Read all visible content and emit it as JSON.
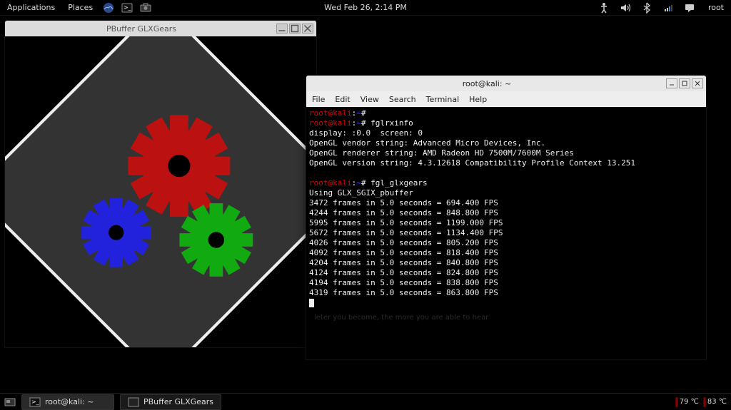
{
  "panel": {
    "applications": "Applications",
    "places": "Places",
    "datetime": "Wed Feb 26,  2:14 PM",
    "user": "root"
  },
  "glxgears_window": {
    "title": "PBuffer GLXGears"
  },
  "terminal_window": {
    "title": "root@kali: ~",
    "menus": {
      "file": "File",
      "edit": "Edit",
      "view": "View",
      "search": "Search",
      "terminal": "Terminal",
      "help": "Help"
    },
    "prompt": {
      "user": "root",
      "host": "kali",
      "path": "~",
      "sep": "@",
      "marker": "#"
    },
    "lines": {
      "cmd1": "",
      "cmd2": "fglrxinfo",
      "out_display": "display: :0.0  screen: 0",
      "out_vendor": "OpenGL vendor string: Advanced Micro Devices, Inc.",
      "out_renderer": "OpenGL renderer string: AMD Radeon HD 7500M/7600M Series",
      "out_version": "OpenGL version string: 4.3.12618 Compatibility Profile Context 13.251",
      "blank": "",
      "cmd3": "fgl_glxgears",
      "using": "Using GLX_SGIX_pbuffer",
      "fps": [
        "3472 frames in 5.0 seconds = 694.400 FPS",
        "4244 frames in 5.0 seconds = 848.800 FPS",
        "5995 frames in 5.0 seconds = 1199.000 FPS",
        "5672 frames in 5.0 seconds = 1134.400 FPS",
        "4026 frames in 5.0 seconds = 805.200 FPS",
        "4092 frames in 5.0 seconds = 818.400 FPS",
        "4204 frames in 5.0 seconds = 840.800 FPS",
        "4124 frames in 5.0 seconds = 824.800 FPS",
        "4194 frames in 5.0 seconds = 838.800 FPS",
        "4319 frames in 5.0 seconds = 863.800 FPS"
      ]
    }
  },
  "taskbar": {
    "task1": "root@kali: ~",
    "task2": "PBuffer GLXGears"
  },
  "temps": {
    "t1": "79 ℃",
    "t2": "83 ℃"
  },
  "watermark": "ieter you become, the more you are able to hear",
  "chart_data": {
    "type": "table",
    "title": "fgl_glxgears output",
    "columns": [
      "frames",
      "seconds",
      "fps"
    ],
    "rows": [
      [
        3472,
        5.0,
        694.4
      ],
      [
        4244,
        5.0,
        848.8
      ],
      [
        5995,
        5.0,
        1199.0
      ],
      [
        5672,
        5.0,
        1134.4
      ],
      [
        4026,
        5.0,
        805.2
      ],
      [
        4092,
        5.0,
        818.4
      ],
      [
        4204,
        5.0,
        840.8
      ],
      [
        4124,
        5.0,
        824.8
      ],
      [
        4194,
        5.0,
        838.8
      ],
      [
        4319,
        5.0,
        863.8
      ]
    ]
  }
}
